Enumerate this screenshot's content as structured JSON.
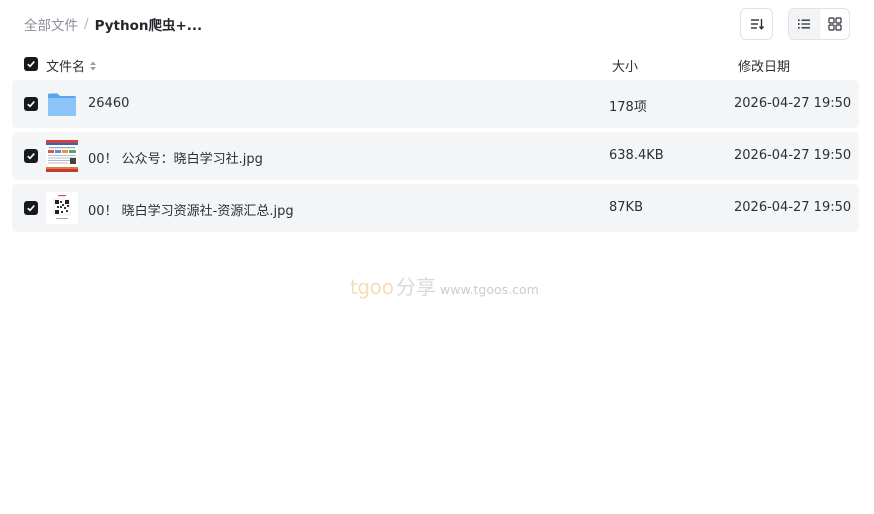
{
  "breadcrumb": {
    "root": "全部文件",
    "separator": "/",
    "current": "Python爬虫+..."
  },
  "toolbar": {
    "sort_icon": "sort-list-icon",
    "list_view_icon": "list-view-icon",
    "grid_view_icon": "grid-view-icon",
    "active_view": "list"
  },
  "header": {
    "name": "文件名",
    "size": "大小",
    "date": "修改日期"
  },
  "files": [
    {
      "name": "26460",
      "size": "178项",
      "date": "2026-04-27 19:50",
      "type": "folder",
      "checked": true
    },
    {
      "name": "00！ 公众号：晓白学习社.jpg",
      "size": "638.4KB",
      "date": "2026-04-27 19:50",
      "type": "image-poster",
      "checked": true
    },
    {
      "name": "00！ 晓白学习资源社-资源汇总.jpg",
      "size": "87KB",
      "date": "2026-04-27 19:50",
      "type": "image-qrcode",
      "checked": true
    }
  ],
  "watermark": {
    "brand_a": "tg",
    "brand_b": "oo",
    "brand_cn": "分享",
    "url": "www.tgoos.com"
  },
  "colors": {
    "row_background": "#f4f5f6",
    "checkbox": "#17191c",
    "folder": "#7ab8f5"
  }
}
